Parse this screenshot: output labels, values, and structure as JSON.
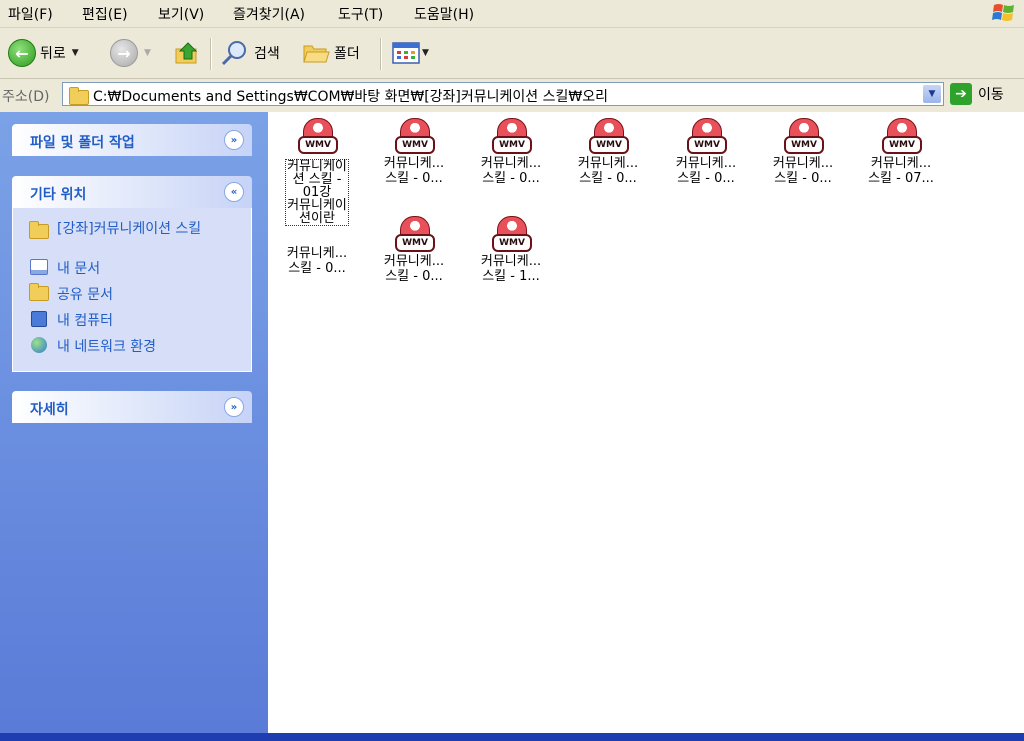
{
  "menu": {
    "items": [
      "파일(F)",
      "편집(E)",
      "보기(V)",
      "즐겨찾기(A)",
      "도구(T)",
      "도움말(H)"
    ]
  },
  "toolbar": {
    "back_label": "뒤로",
    "search_label": "검색",
    "folders_label": "폴더"
  },
  "address": {
    "label": "주소(D)",
    "path": "C:₩Documents and Settings₩COM₩바탕 화면₩[강좌]커뮤니케이션 스킬₩오리",
    "go_label": "이동"
  },
  "sidepane": {
    "tasks_title": "파일 및 폴더 작업",
    "other_title": "기타 위치",
    "other_links": [
      "[강좌]커뮤니케이션 스킬",
      "내 문서",
      "공유 문서",
      "내 컴퓨터",
      "내 네트워크 환경"
    ],
    "details_title": "자세히"
  },
  "files": [
    {
      "name": "커뮤니케이\n션 스킬 -\n01강\n커뮤니케이\n션이란",
      "selected": true
    },
    {
      "name": "커뮤니케...\n스킬 - 0..."
    },
    {
      "name": "커뮤니케...\n스킬 - 0..."
    },
    {
      "name": "커뮤니케...\n스킬 - 0..."
    },
    {
      "name": "커뮤니케...\n스킬 - 0..."
    },
    {
      "name": "커뮤니케...\n스킬 - 0..."
    },
    {
      "name": "커뮤니케...\n스킬 - 07..."
    },
    {
      "name": "커뮤니케...\n스킬 - 0..."
    },
    {
      "name": "커뮤니케...\n스킬 - 0..."
    },
    {
      "name": "커뮤니케...\n스킬 - 1..."
    }
  ],
  "file_icon_text": "WMV"
}
